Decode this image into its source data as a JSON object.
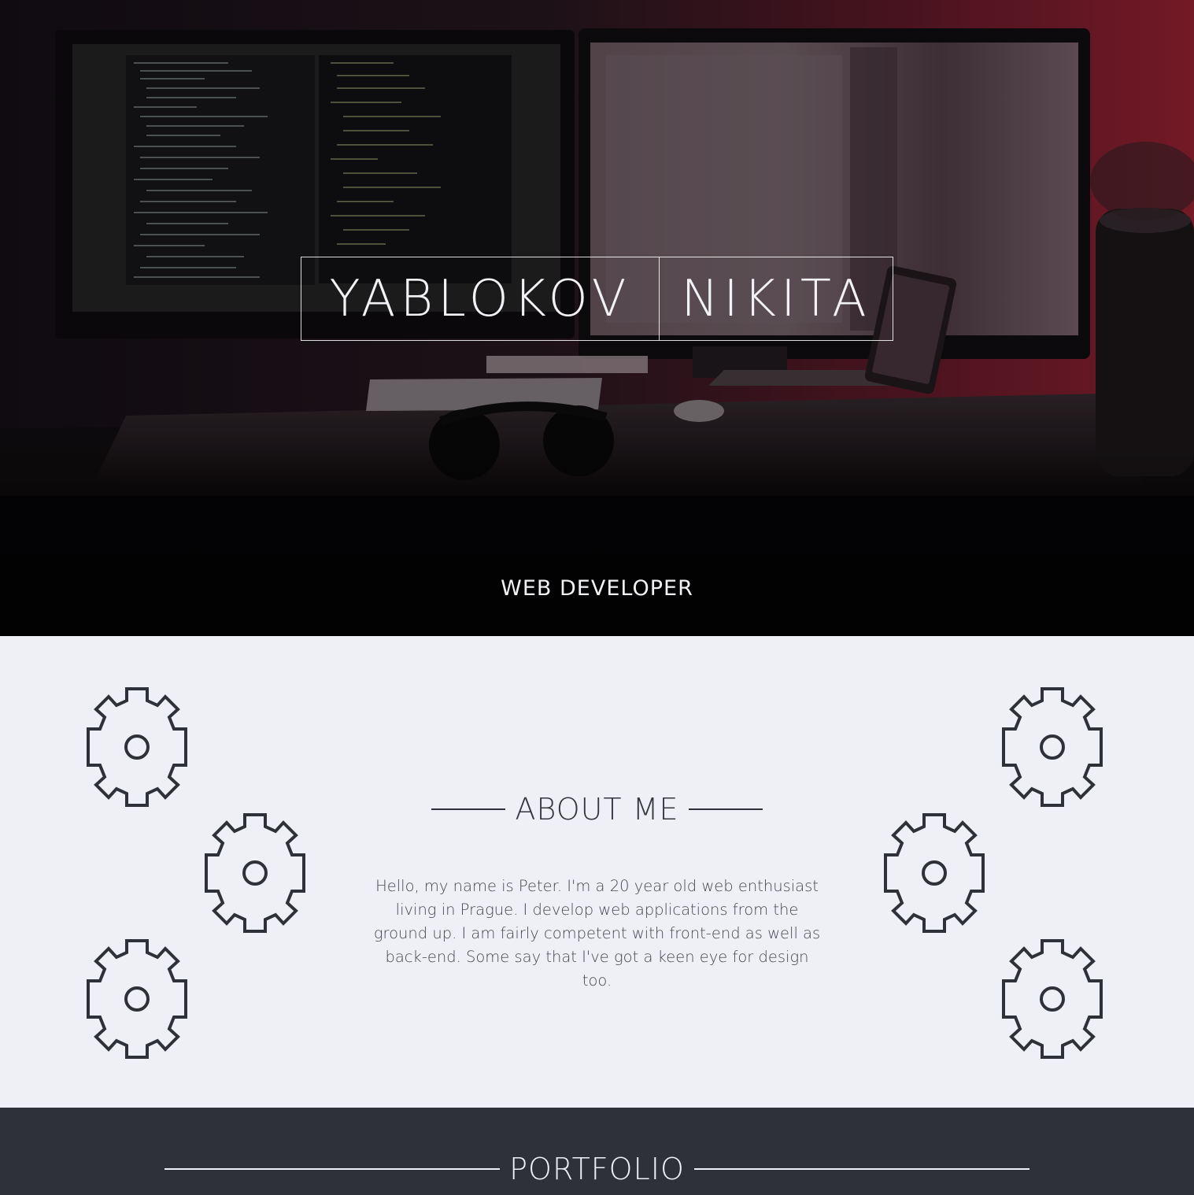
{
  "hero": {
    "first_name": "YABLOKOV",
    "last_name": "NIKITA",
    "role": "WEB DEVELOPER"
  },
  "about": {
    "heading": "ABOUT ME",
    "text": "Hello, my name is Peter. I'm a 20 year old web enthusiast living in Prague. I develop web applications from the ground up. I am fairly competent with front-end as well as back-end. Some say that I've got a keen eye for design too."
  },
  "portfolio": {
    "heading": "PORTFOLIO"
  },
  "colors": {
    "hero_overlay_red": "#6b1622",
    "about_background": "#efeff6",
    "gear_stroke": "#2f3139",
    "portfolio_background": "#2f3139",
    "light_text": "#f2f2f6"
  },
  "icons": [
    "gear-icon"
  ]
}
